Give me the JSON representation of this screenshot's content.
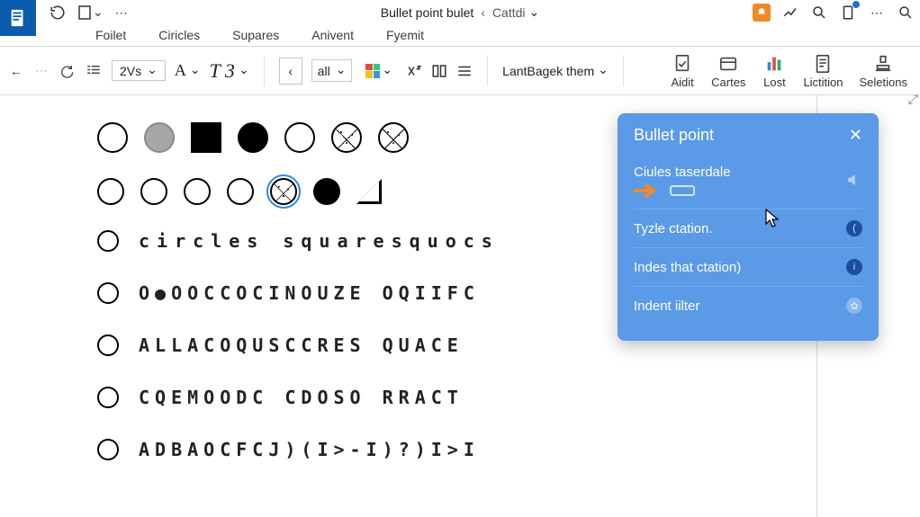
{
  "titlebar": {
    "doc_title": "Bullet point bulet",
    "crumb_name": "Cattdi"
  },
  "tabs": [
    "Foilet",
    "Ciricles",
    "Supares",
    "Anivent",
    "Fyemit"
  ],
  "toolbar": {
    "zoom_label": "2Vs",
    "font_letter": "A",
    "style_letters": "T 3",
    "all_label": "all",
    "theme_label": "LantBagek them"
  },
  "ribbon": [
    {
      "name": "audit",
      "label": "Aidit"
    },
    {
      "name": "cartes",
      "label": "Cartes"
    },
    {
      "name": "lost",
      "label": "Lost"
    },
    {
      "name": "lictation",
      "label": "Lictition"
    },
    {
      "name": "seletions",
      "label": "Seletions"
    }
  ],
  "shapes_row1": [
    {
      "kind": "outline"
    },
    {
      "kind": "solid-gray"
    },
    {
      "kind": "square"
    },
    {
      "kind": "solid-black"
    },
    {
      "kind": "outline"
    },
    {
      "kind": "hatched"
    },
    {
      "kind": "hatched"
    }
  ],
  "shapes_row2": [
    {
      "kind": "outline"
    },
    {
      "kind": "outline"
    },
    {
      "kind": "outline"
    },
    {
      "kind": "outline"
    },
    {
      "kind": "hatched",
      "selected": true
    },
    {
      "kind": "solid-black"
    },
    {
      "kind": "triangle"
    }
  ],
  "lines": [
    "circles squaresquocs",
    "O●OOCCOCINOUZE OQIIFC",
    "ALLACOQUSCCRES QUACE",
    "CQeMOODC CDOSO RRACT",
    "ADBAOCFCJ)(I>-I)?)I>I"
  ],
  "panel": {
    "title": "Bullet point",
    "rows": [
      {
        "label": "Ciules taserdale",
        "icon": "speaker"
      },
      {
        "label": "Tyzle ctation.",
        "icon": "info"
      },
      {
        "label": "Indes that ctation)",
        "icon": "info"
      },
      {
        "label": "Indent iilter",
        "icon": "gear"
      }
    ]
  }
}
